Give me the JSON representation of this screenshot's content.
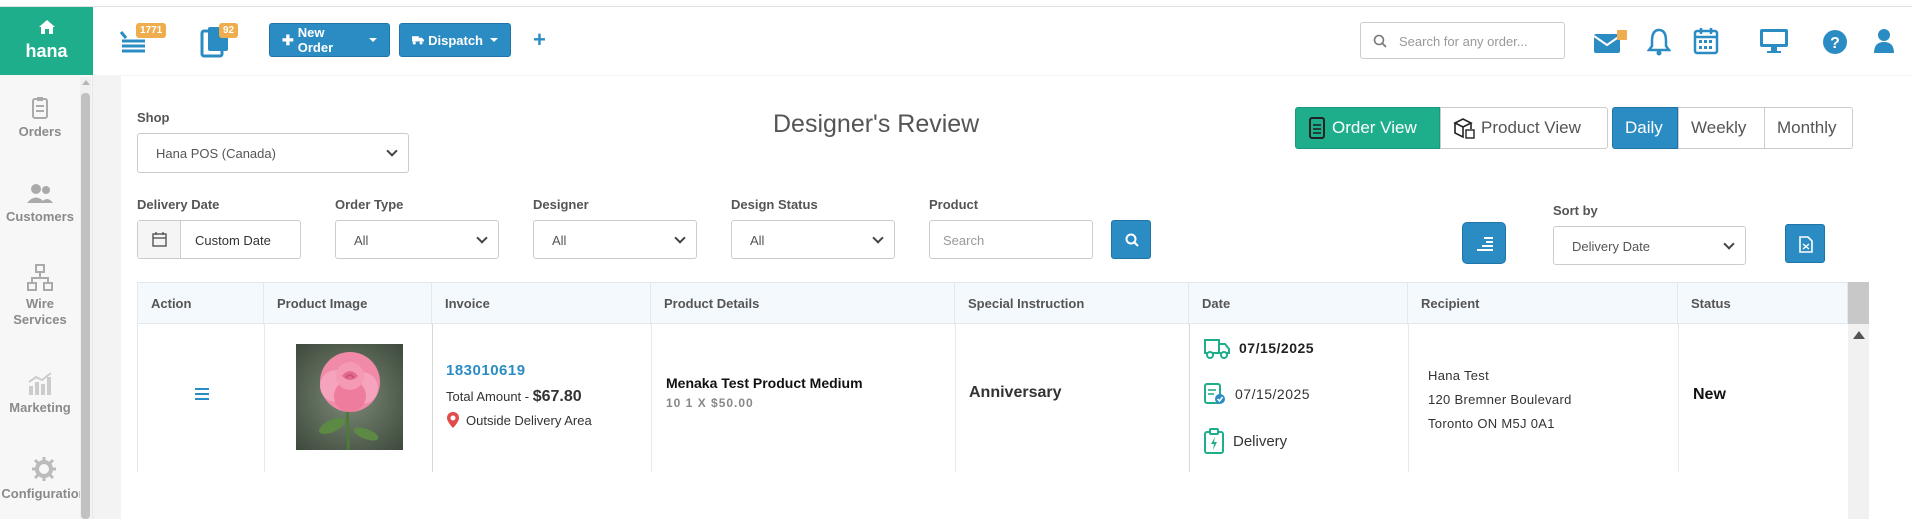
{
  "sidebar": {
    "brand": "hana",
    "items": [
      {
        "label": "Orders"
      },
      {
        "label": "Customers"
      },
      {
        "label": "Wire Services"
      },
      {
        "label": "Marketing"
      },
      {
        "label": "Configuration"
      }
    ]
  },
  "topbar": {
    "orders_badge": "1771",
    "tasks_badge": "92",
    "new_order_label": "New Order",
    "dispatch_label": "Dispatch",
    "plus_label": "+",
    "search_placeholder": "Search for any order..."
  },
  "page": {
    "title": "Designer's Review",
    "shop_label": "Shop",
    "shop_value": "Hana POS (Canada)",
    "view_toggle": {
      "order_view": "Order View",
      "product_view": "Product View"
    },
    "period_toggle": {
      "daily": "Daily",
      "weekly": "Weekly",
      "monthly": "Monthly"
    },
    "filters": {
      "delivery_date_label": "Delivery Date",
      "delivery_date_value": "Custom Date",
      "order_type_label": "Order Type",
      "order_type_value": "All",
      "designer_label": "Designer",
      "designer_value": "All",
      "design_status_label": "Design Status",
      "design_status_value": "All",
      "product_label": "Product",
      "product_placeholder": "Search",
      "sort_by_label": "Sort by",
      "sort_by_value": "Delivery Date"
    }
  },
  "table": {
    "columns": [
      "Action",
      "Product Image",
      "Invoice",
      "Product Details",
      "Special Instruction",
      "Date",
      "Recipient",
      "Status"
    ],
    "rows": [
      {
        "invoice": "183010619",
        "total_label": "Total Amount - ",
        "total_value": "$67.80",
        "area": "Outside Delivery Area",
        "product_name": "Menaka Test Product Medium",
        "product_qty": "10 1 X $50.00",
        "instruction": "Anniversary",
        "delivery_date": "07/15/2025",
        "order_date": "07/15/2025",
        "order_type": "Delivery",
        "recipient_name": "Hana Test",
        "recipient_address": "120 Bremner Boulevard",
        "recipient_city": "Toronto ON M5J 0A1",
        "status": "New"
      }
    ]
  },
  "colors": {
    "brand_green": "#1fae8c",
    "primary_blue": "#2b8cc4",
    "badge_orange": "#f0ad4e",
    "pin_red": "#e04b4b"
  }
}
